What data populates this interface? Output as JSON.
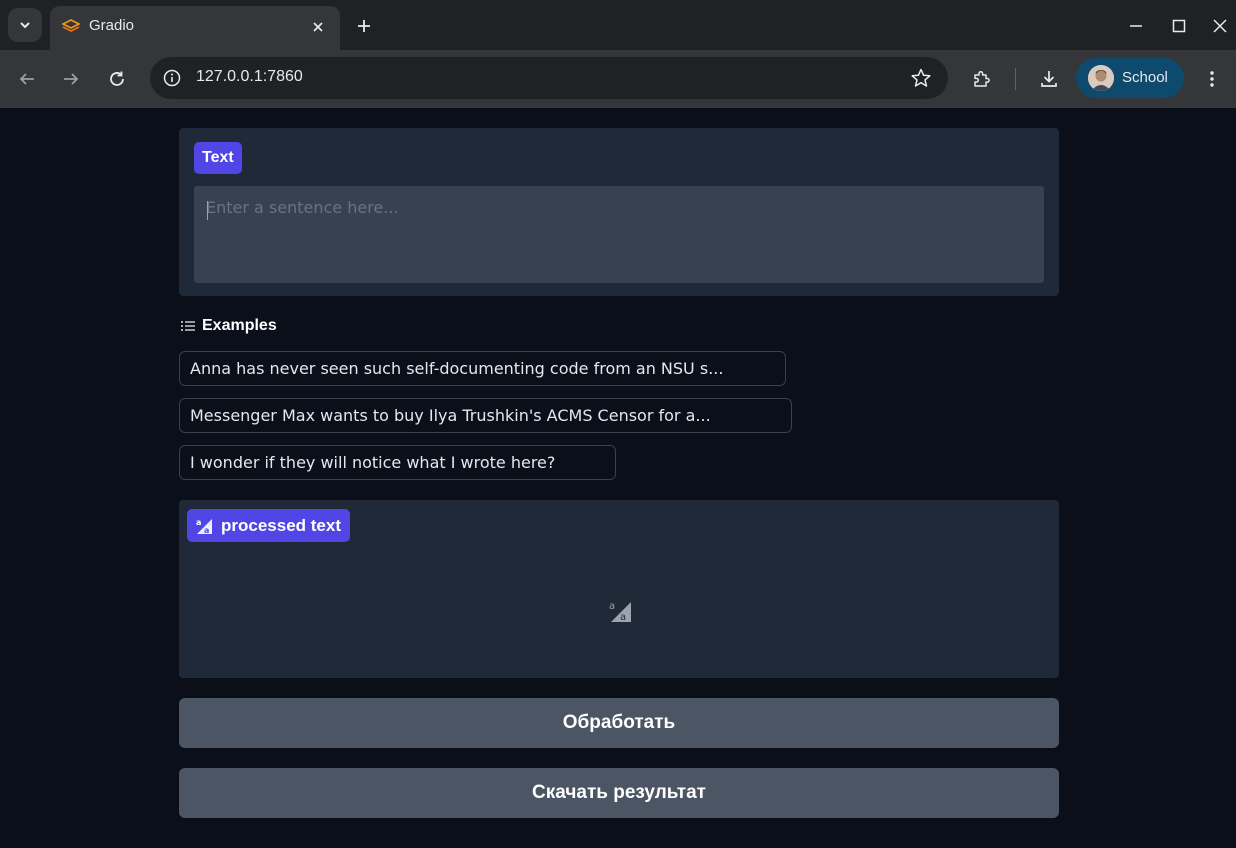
{
  "browser": {
    "tab_title": "Gradio",
    "url": "127.0.0.1:7860",
    "profile_name": "School",
    "accent_color": "#0e4a6e"
  },
  "input_block": {
    "label": "Text",
    "placeholder": "Enter a sentence here..."
  },
  "examples": {
    "title": "Examples",
    "items": [
      "Anna has never seen such self-documenting code from an NSU s...",
      "Messenger Max wants to buy Ilya Trushkin's ACMS Censor for a...",
      "I wonder if they will notice what I wrote here?"
    ]
  },
  "output_block": {
    "label": "processed text",
    "icon": "translate-icon"
  },
  "buttons": {
    "process": "Обработать",
    "download": "Скачать результат"
  },
  "colors": {
    "label_chip": "#4f46e5",
    "block_bg": "#1f2937",
    "button_bg": "#4b5563",
    "page_bg": "#0b0f19"
  }
}
